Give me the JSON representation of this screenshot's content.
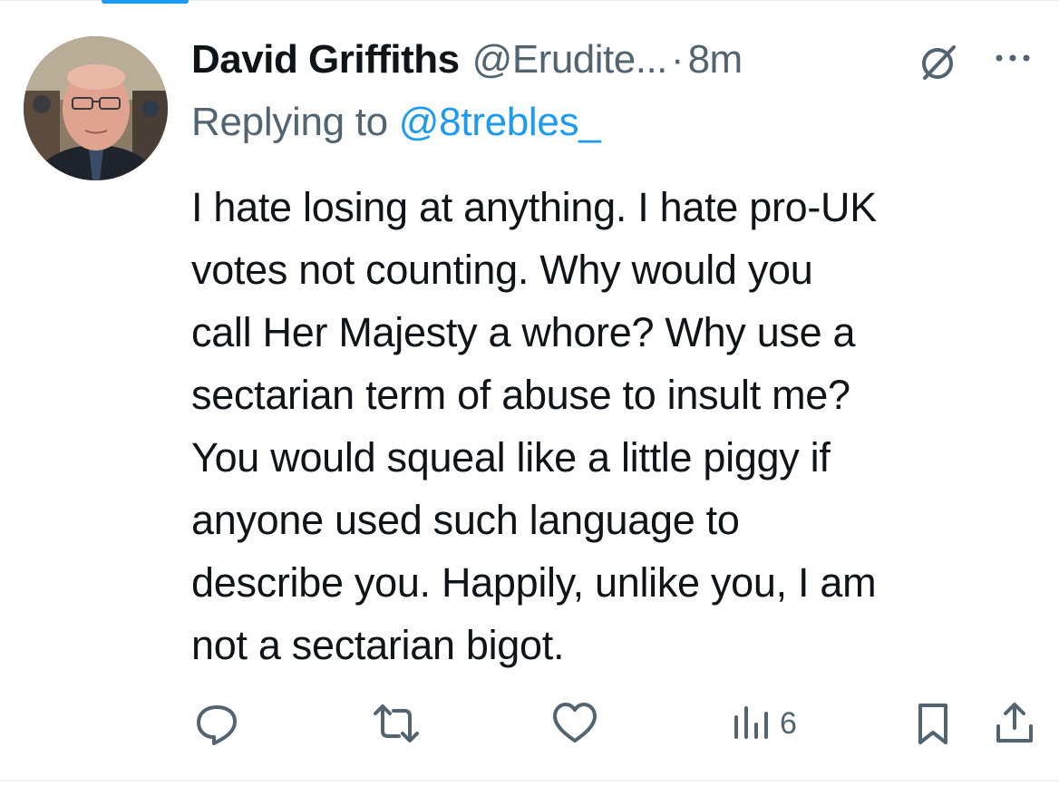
{
  "tweet": {
    "author": {
      "display_name": "David Griffiths",
      "handle": "@Erudite...",
      "separator": "·",
      "time": "8m"
    },
    "reply": {
      "prefix": "Replying to",
      "handle": "@8trebles_"
    },
    "body_lines": [
      "I hate losing at anything. I hate pro-UK",
      "votes not counting. Why would you",
      "call Her Majesty a whore? Why use a",
      "sectarian term of abuse to insult me?",
      "You would squeal like a little piggy if",
      "anyone used such language to",
      "describe you. Happily, unlike you, I am",
      "not a sectarian bigot."
    ],
    "actions": {
      "reply_icon": "reply-icon",
      "retweet_icon": "retweet-icon",
      "like_icon": "heart-icon",
      "views_icon": "views-icon",
      "views_count": "6",
      "bookmark_icon": "bookmark-icon",
      "share_icon": "share-icon"
    }
  },
  "colors": {
    "text_primary": "#0f1419",
    "text_secondary": "#536471",
    "link": "#1d9bf0"
  }
}
